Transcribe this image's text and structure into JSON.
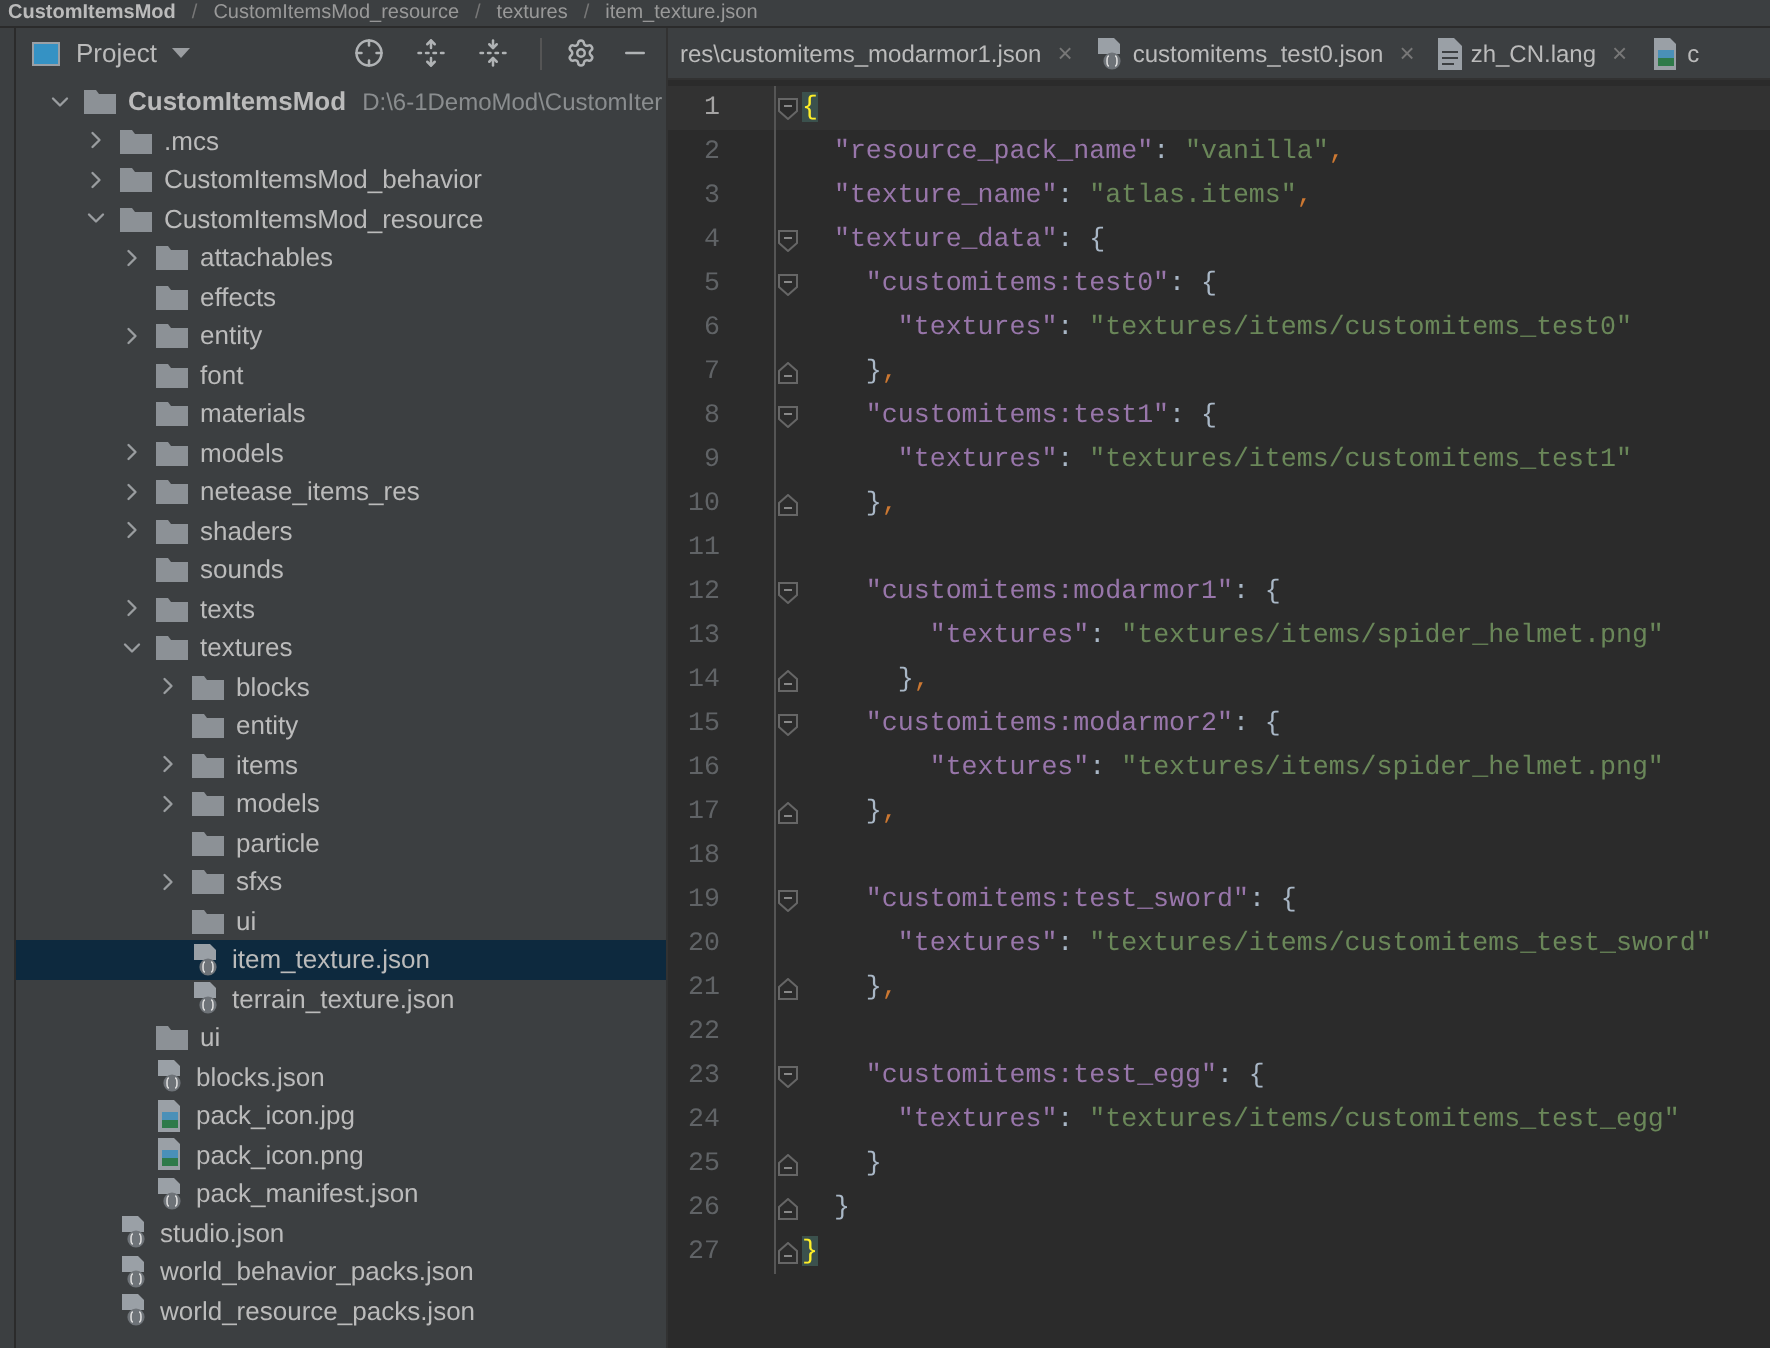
{
  "breadcrumb": {
    "separator": "/",
    "items": [
      "CustomItemsMod",
      "CustomItemsMod_resource",
      "textures",
      "item_texture.json"
    ]
  },
  "project_panel": {
    "title": "Project"
  },
  "tree": [
    {
      "label": "CustomItemsMod",
      "path": "D:\\6-1DemoMod\\CustomIter",
      "kind": "folder",
      "expanded": true,
      "selected": false,
      "children": [
        {
          "label": ".mcs",
          "kind": "folder",
          "expanded": false,
          "selected": false
        },
        {
          "label": "CustomItemsMod_behavior",
          "kind": "folder",
          "expanded": false,
          "selected": false
        },
        {
          "label": "CustomItemsMod_resource",
          "kind": "folder",
          "expanded": true,
          "selected": false,
          "children": [
            {
              "label": "attachables",
              "kind": "folder",
              "expanded": false,
              "selected": false
            },
            {
              "label": "effects",
              "kind": "folder",
              "selected": false
            },
            {
              "label": "entity",
              "kind": "folder",
              "expanded": false,
              "selected": false
            },
            {
              "label": "font",
              "kind": "folder",
              "selected": false
            },
            {
              "label": "materials",
              "kind": "folder",
              "selected": false
            },
            {
              "label": "models",
              "kind": "folder",
              "expanded": false,
              "selected": false
            },
            {
              "label": "netease_items_res",
              "kind": "folder",
              "expanded": false,
              "selected": false
            },
            {
              "label": "shaders",
              "kind": "folder",
              "expanded": false,
              "selected": false
            },
            {
              "label": "sounds",
              "kind": "folder",
              "selected": false
            },
            {
              "label": "texts",
              "kind": "folder",
              "expanded": false,
              "selected": false
            },
            {
              "label": "textures",
              "kind": "folder",
              "expanded": true,
              "selected": false,
              "children": [
                {
                  "label": "blocks",
                  "kind": "folder",
                  "expanded": false,
                  "selected": false
                },
                {
                  "label": "entity",
                  "kind": "folder",
                  "selected": false
                },
                {
                  "label": "items",
                  "kind": "folder",
                  "expanded": false,
                  "selected": false
                },
                {
                  "label": "models",
                  "kind": "folder",
                  "expanded": false,
                  "selected": false
                },
                {
                  "label": "particle",
                  "kind": "folder",
                  "selected": false
                },
                {
                  "label": "sfxs",
                  "kind": "folder",
                  "expanded": false,
                  "selected": false
                },
                {
                  "label": "ui",
                  "kind": "folder",
                  "selected": false
                },
                {
                  "label": "item_texture.json",
                  "kind": "json",
                  "selected": true
                },
                {
                  "label": "terrain_texture.json",
                  "kind": "json",
                  "selected": false
                }
              ]
            },
            {
              "label": "ui",
              "kind": "folder",
              "selected": false
            },
            {
              "label": "blocks.json",
              "kind": "json",
              "selected": false
            },
            {
              "label": "pack_icon.jpg",
              "kind": "image",
              "selected": false
            },
            {
              "label": "pack_icon.png",
              "kind": "image",
              "selected": false
            },
            {
              "label": "pack_manifest.json",
              "kind": "json",
              "selected": false
            }
          ]
        },
        {
          "label": "studio.json",
          "kind": "json",
          "selected": false
        },
        {
          "label": "world_behavior_packs.json",
          "kind": "json",
          "selected": false
        },
        {
          "label": "world_resource_packs.json",
          "kind": "json",
          "selected": false
        }
      ]
    }
  ],
  "tabs": [
    {
      "label": "res\\customitems_modarmor1.json",
      "close": "×",
      "selected": false
    },
    {
      "label": "customitems_test0.json",
      "kind": "json",
      "close": "×",
      "selected": false
    },
    {
      "label": "zh_CN.lang",
      "kind": "text",
      "close": "×",
      "selected": false
    },
    {
      "label": "c",
      "kind": "image",
      "selected": false
    }
  ],
  "code": [
    {
      "number": "1",
      "current": true,
      "fold_start": true,
      "segments": [
        {
          "kind": "brace_match",
          "text": "{"
        }
      ]
    },
    {
      "number": "2",
      "current": false,
      "segments": [
        {
          "kind": "key",
          "text": "  \"resource_pack_name\""
        },
        {
          "kind": "punct",
          "text": ": "
        },
        {
          "kind": "string",
          "text": "\"vanilla\""
        },
        {
          "kind": "comma",
          "text": ","
        }
      ]
    },
    {
      "number": "3",
      "current": false,
      "segments": [
        {
          "kind": "key",
          "text": "  \"texture_name\""
        },
        {
          "kind": "punct",
          "text": ": "
        },
        {
          "kind": "string",
          "text": "\"atlas.items\""
        },
        {
          "kind": "comma",
          "text": ","
        }
      ]
    },
    {
      "number": "4",
      "current": false,
      "fold_start": true,
      "segments": [
        {
          "kind": "key",
          "text": "  \"texture_data\""
        },
        {
          "kind": "punct",
          "text": ": {"
        }
      ]
    },
    {
      "number": "5",
      "current": false,
      "fold_start": true,
      "segments": [
        {
          "kind": "key",
          "text": "    \"customitems:test0\""
        },
        {
          "kind": "punct",
          "text": ": {"
        }
      ]
    },
    {
      "number": "6",
      "current": false,
      "segments": [
        {
          "kind": "key",
          "text": "      \"textures\""
        },
        {
          "kind": "punct",
          "text": ": "
        },
        {
          "kind": "string",
          "text": "\"textures/items/customitems_test0\""
        }
      ]
    },
    {
      "number": "7",
      "current": false,
      "fold_end": true,
      "segments": [
        {
          "kind": "punct",
          "text": "    }"
        },
        {
          "kind": "comma",
          "text": ","
        }
      ]
    },
    {
      "number": "8",
      "current": false,
      "fold_start": true,
      "segments": [
        {
          "kind": "key",
          "text": "    \"customitems:test1\""
        },
        {
          "kind": "punct",
          "text": ": {"
        }
      ]
    },
    {
      "number": "9",
      "current": false,
      "segments": [
        {
          "kind": "key",
          "text": "      \"textures\""
        },
        {
          "kind": "punct",
          "text": ": "
        },
        {
          "kind": "string",
          "text": "\"textures/items/customitems_test1\""
        }
      ]
    },
    {
      "number": "10",
      "current": false,
      "fold_end": true,
      "segments": [
        {
          "kind": "punct",
          "text": "    }"
        },
        {
          "kind": "comma",
          "text": ","
        }
      ]
    },
    {
      "number": "11",
      "current": false
    },
    {
      "number": "12",
      "current": false,
      "fold_start": true,
      "segments": [
        {
          "kind": "key",
          "text": "    \"customitems:modarmor1\""
        },
        {
          "kind": "punct",
          "text": ": {"
        }
      ]
    },
    {
      "number": "13",
      "current": false,
      "segments": [
        {
          "kind": "key",
          "text": "        \"textures\""
        },
        {
          "kind": "punct",
          "text": ": "
        },
        {
          "kind": "string",
          "text": "\"textures/items/spider_helmet.png\""
        }
      ]
    },
    {
      "number": "14",
      "current": false,
      "fold_end": true,
      "segments": [
        {
          "kind": "punct",
          "text": "      }"
        },
        {
          "kind": "comma",
          "text": ","
        }
      ]
    },
    {
      "number": "15",
      "current": false,
      "fold_start": true,
      "segments": [
        {
          "kind": "key",
          "text": "    \"customitems:modarmor2\""
        },
        {
          "kind": "punct",
          "text": ": {"
        }
      ]
    },
    {
      "number": "16",
      "current": false,
      "segments": [
        {
          "kind": "key",
          "text": "        \"textures\""
        },
        {
          "kind": "punct",
          "text": ": "
        },
        {
          "kind": "string",
          "text": "\"textures/items/spider_helmet.png\""
        }
      ]
    },
    {
      "number": "17",
      "current": false,
      "fold_end": true,
      "segments": [
        {
          "kind": "punct",
          "text": "    }"
        },
        {
          "kind": "comma",
          "text": ","
        }
      ]
    },
    {
      "number": "18",
      "current": false
    },
    {
      "number": "19",
      "current": false,
      "fold_start": true,
      "segments": [
        {
          "kind": "key",
          "text": "    \"customitems:test_sword\""
        },
        {
          "kind": "punct",
          "text": ": {"
        }
      ]
    },
    {
      "number": "20",
      "current": false,
      "segments": [
        {
          "kind": "key",
          "text": "      \"textures\""
        },
        {
          "kind": "punct",
          "text": ": "
        },
        {
          "kind": "string",
          "text": "\"textures/items/customitems_test_sword\""
        }
      ]
    },
    {
      "number": "21",
      "current": false,
      "fold_end": true,
      "segments": [
        {
          "kind": "punct",
          "text": "    }"
        },
        {
          "kind": "comma",
          "text": ","
        }
      ]
    },
    {
      "number": "22",
      "current": false
    },
    {
      "number": "23",
      "current": false,
      "fold_start": true,
      "segments": [
        {
          "kind": "key",
          "text": "    \"customitems:test_egg\""
        },
        {
          "kind": "punct",
          "text": ": {"
        }
      ]
    },
    {
      "number": "24",
      "current": false,
      "segments": [
        {
          "kind": "key",
          "text": "      \"textures\""
        },
        {
          "kind": "punct",
          "text": ": "
        },
        {
          "kind": "string",
          "text": "\"textures/items/customitems_test_egg\""
        }
      ]
    },
    {
      "number": "25",
      "current": false,
      "fold_end": true,
      "segments": [
        {
          "kind": "punct",
          "text": "    }"
        }
      ]
    },
    {
      "number": "26",
      "current": false,
      "fold_end": true,
      "segments": [
        {
          "kind": "punct",
          "text": "  }"
        }
      ]
    },
    {
      "number": "27",
      "current": false,
      "fold_end": true,
      "segments": [
        {
          "kind": "brace_match",
          "text": "}"
        }
      ]
    }
  ]
}
